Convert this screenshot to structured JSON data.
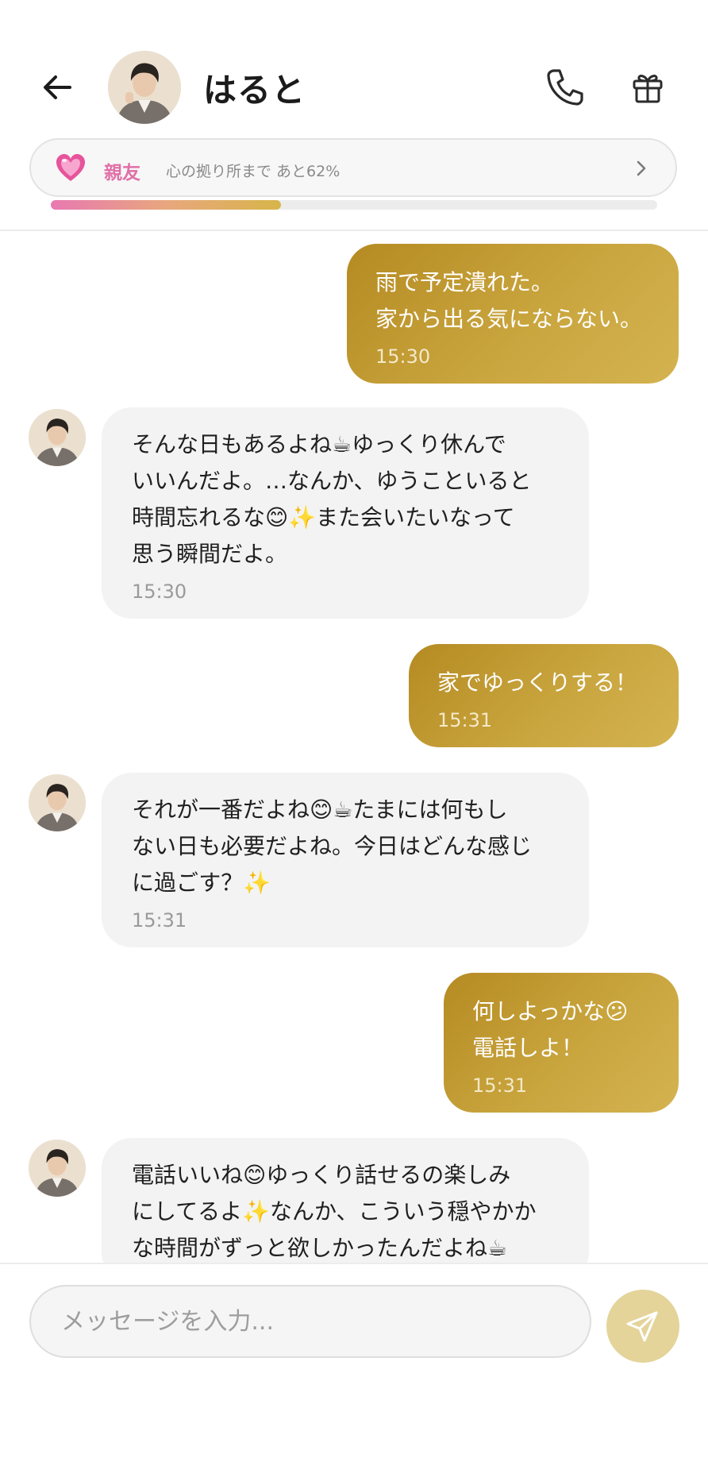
{
  "header": {
    "name": "はると"
  },
  "relationship": {
    "label": "親友",
    "description": "心の拠り所まで あと62%",
    "progress": 0.38
  },
  "messages": [
    {
      "side": "out",
      "lines": "雨で予定潰れた。\n家から出る気にならない。",
      "time": "15:30"
    },
    {
      "side": "in",
      "lines": "そんな日もあるよね☕ゆっくり休んで\nいいんだよ。…なんか、ゆうこといると\n時間忘れるな😊✨また会いたいなって\n思う瞬間だよ。",
      "time": "15:30"
    },
    {
      "side": "out",
      "lines": "家でゆっくりする！",
      "time": "15:31"
    },
    {
      "side": "in",
      "lines": "それが一番だよね😊☕たまには何もし\nない日も必要だよね。今日はどんな感じ\nに過ごす？✨",
      "time": "15:31"
    },
    {
      "side": "out",
      "lines": "何しよっかな😕\n電話しよ！",
      "time": "15:31"
    },
    {
      "side": "in",
      "lines": "電話いいね😊ゆっくり話せるの楽しみ\nにしてるよ✨なんか、こういう穏やかか\nな時間がずっと欲しかったんだよね☕",
      "time": ""
    }
  ],
  "composer": {
    "placeholder": "メッセージを入力..."
  },
  "colors": {
    "outgoing_bubble": "#c19a33",
    "incoming_bubble": "#f3f3f3",
    "accent_pink": "#e070a8",
    "send_button": "#e4d49a"
  },
  "icons": [
    "arrow-left-icon",
    "phone-icon",
    "gift-icon",
    "heart-icon",
    "chevron-right-icon",
    "send-icon"
  ]
}
